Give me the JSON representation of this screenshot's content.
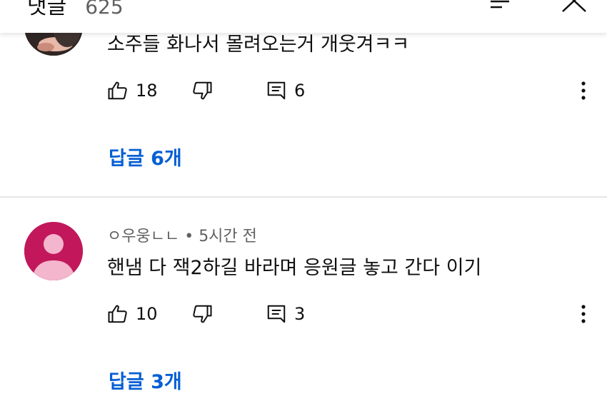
{
  "header": {
    "title": "댓글",
    "count": "625"
  },
  "comments": [
    {
      "text": "소주들 화나서 몰려오는거 개웃겨ㅋㅋ",
      "likes": "18",
      "replies_count": "6",
      "replies_link": "답글 6개"
    },
    {
      "author": "ㅇ우웅ㄴㄴ",
      "separator": "•",
      "time": "5시간 전",
      "text": "핸냄 다 잭2하길 바라며 응원글 놓고 간다 이기",
      "likes": "10",
      "replies_count": "3",
      "replies_link": "답글 3개"
    }
  ],
  "colors": {
    "link_blue": "#065fd4",
    "avatar_bg": "#c2185b",
    "avatar_figure": "#f3b6cc",
    "secondary_text": "#606060"
  },
  "icons": [
    "sort-icon",
    "close-icon",
    "thumbs-up-icon",
    "thumbs-down-icon",
    "reply-icon",
    "more-vert-icon"
  ]
}
